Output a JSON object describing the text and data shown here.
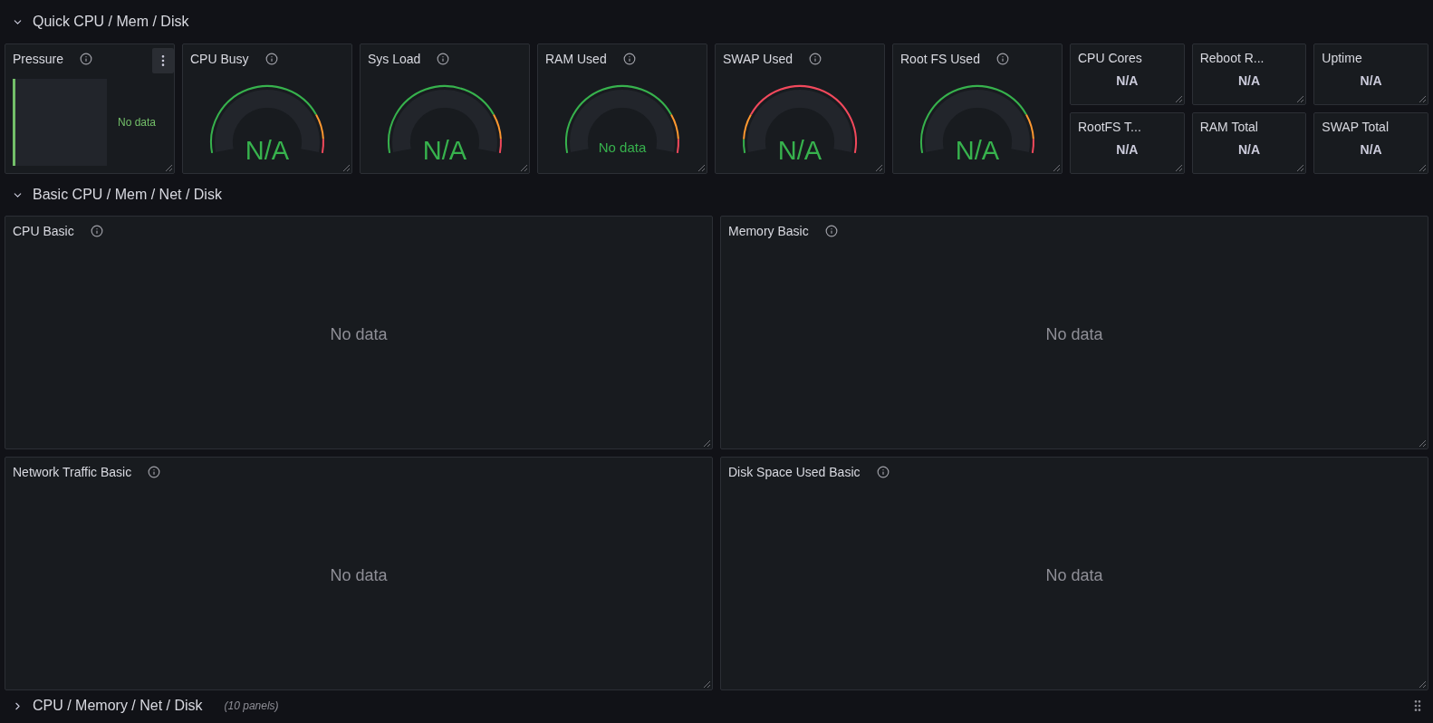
{
  "rows": [
    {
      "title": "Quick CPU / Mem / Disk",
      "collapsed": false,
      "quick_panels": [
        {
          "kind": "bargauge",
          "title": "Pressure",
          "value": "No data",
          "menu_visible": true
        },
        {
          "kind": "gauge",
          "title": "CPU Busy",
          "value": "N/A",
          "no_data": false
        },
        {
          "kind": "gauge",
          "title": "Sys Load",
          "value": "N/A",
          "no_data": false
        },
        {
          "kind": "gauge",
          "title": "RAM Used",
          "value": "No data",
          "no_data": true
        },
        {
          "kind": "gauge-inverted",
          "title": "SWAP Used",
          "value": "N/A",
          "no_data": false
        },
        {
          "kind": "gauge",
          "title": "Root FS Used",
          "value": "N/A",
          "no_data": false
        },
        {
          "kind": "stat",
          "title": "CPU Cores",
          "value": "N/A"
        },
        {
          "kind": "stat",
          "title": "Reboot R...",
          "value": "N/A"
        },
        {
          "kind": "stat",
          "title": "Uptime",
          "value": "N/A"
        },
        {
          "kind": "stat",
          "title": "RootFS T...",
          "value": "N/A"
        },
        {
          "kind": "stat",
          "title": "RAM Total",
          "value": "N/A"
        },
        {
          "kind": "stat",
          "title": "SWAP Total",
          "value": "N/A"
        }
      ]
    },
    {
      "title": "Basic CPU / Mem / Net / Disk",
      "collapsed": false,
      "graph_panels": [
        {
          "title": "CPU Basic",
          "message": "No data"
        },
        {
          "title": "Memory Basic",
          "message": "No data"
        },
        {
          "title": "Network Traffic Basic",
          "message": "No data"
        },
        {
          "title": "Disk Space Used Basic",
          "message": "No data"
        }
      ]
    },
    {
      "title": "CPU / Memory / Net / Disk",
      "collapsed": true,
      "panel_count": "(10 panels)"
    }
  ]
}
